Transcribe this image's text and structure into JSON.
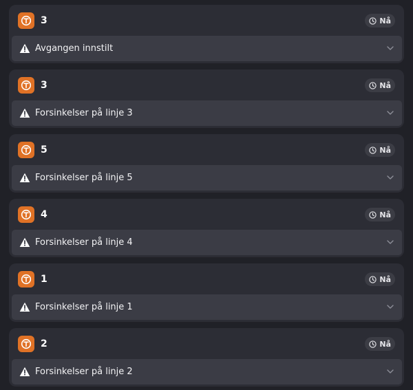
{
  "departures": [
    {
      "line": "3",
      "time_label": "Nå",
      "alert": "Avgangen innstilt",
      "line_icon": "tram-icon",
      "color": "#e07226"
    },
    {
      "line": "3",
      "time_label": "Nå",
      "alert": "Forsinkelser på linje 3",
      "line_icon": "tram-icon",
      "color": "#e07226"
    },
    {
      "line": "5",
      "time_label": "Nå",
      "alert": "Forsinkelser på linje 5",
      "line_icon": "tram-icon",
      "color": "#e07226"
    },
    {
      "line": "4",
      "time_label": "Nå",
      "alert": "Forsinkelser på linje 4",
      "line_icon": "tram-icon",
      "color": "#e07226"
    },
    {
      "line": "1",
      "time_label": "Nå",
      "alert": "Forsinkelser på linje 1",
      "line_icon": "tram-icon",
      "color": "#e07226"
    },
    {
      "line": "2",
      "time_label": "Nå",
      "alert": "Forsinkelser på linje 2",
      "line_icon": "tram-icon",
      "color": "#e07226"
    }
  ]
}
